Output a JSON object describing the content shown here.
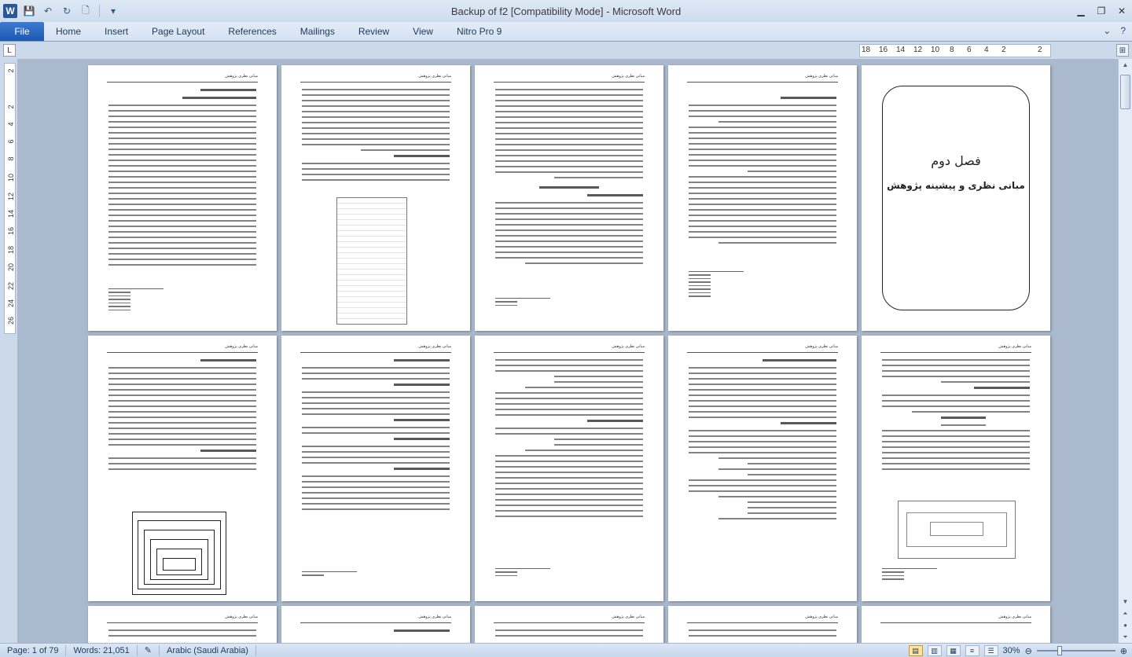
{
  "window": {
    "title": "Backup of f2 [Compatibility Mode]  -  Microsoft Word",
    "app_icon": "W"
  },
  "quick_access": [
    {
      "name": "save-icon",
      "glyph": "💾"
    },
    {
      "name": "undo-icon",
      "glyph": "↶"
    },
    {
      "name": "redo-icon",
      "glyph": "↻"
    },
    {
      "name": "new-document-icon",
      "glyph": "🗋"
    },
    {
      "name": "customize-qat-icon",
      "glyph": "▾"
    }
  ],
  "ribbon": {
    "file_label": "File",
    "tabs": [
      "Home",
      "Insert",
      "Page Layout",
      "References",
      "Mailings",
      "Review",
      "View",
      "Nitro Pro 9"
    ]
  },
  "ruler": {
    "h_numbers": [
      "18",
      "16",
      "14",
      "12",
      "10",
      "8",
      "6",
      "4",
      "2",
      "2"
    ],
    "v_numbers": [
      "2",
      "2",
      "4",
      "6",
      "8",
      "10",
      "12",
      "14",
      "16",
      "18",
      "20",
      "22",
      "24",
      "26"
    ]
  },
  "pages": {
    "header_text": "مبانی نظری پژوهش",
    "cover_title": "فصل دوم",
    "cover_subtitle": "مبانی نظری و پیشینه پژوهش"
  },
  "status": {
    "page": "Page: 1 of 79",
    "words": "Words: 21,051",
    "language": "Arabic (Saudi Arabia)",
    "zoom": "30%"
  }
}
